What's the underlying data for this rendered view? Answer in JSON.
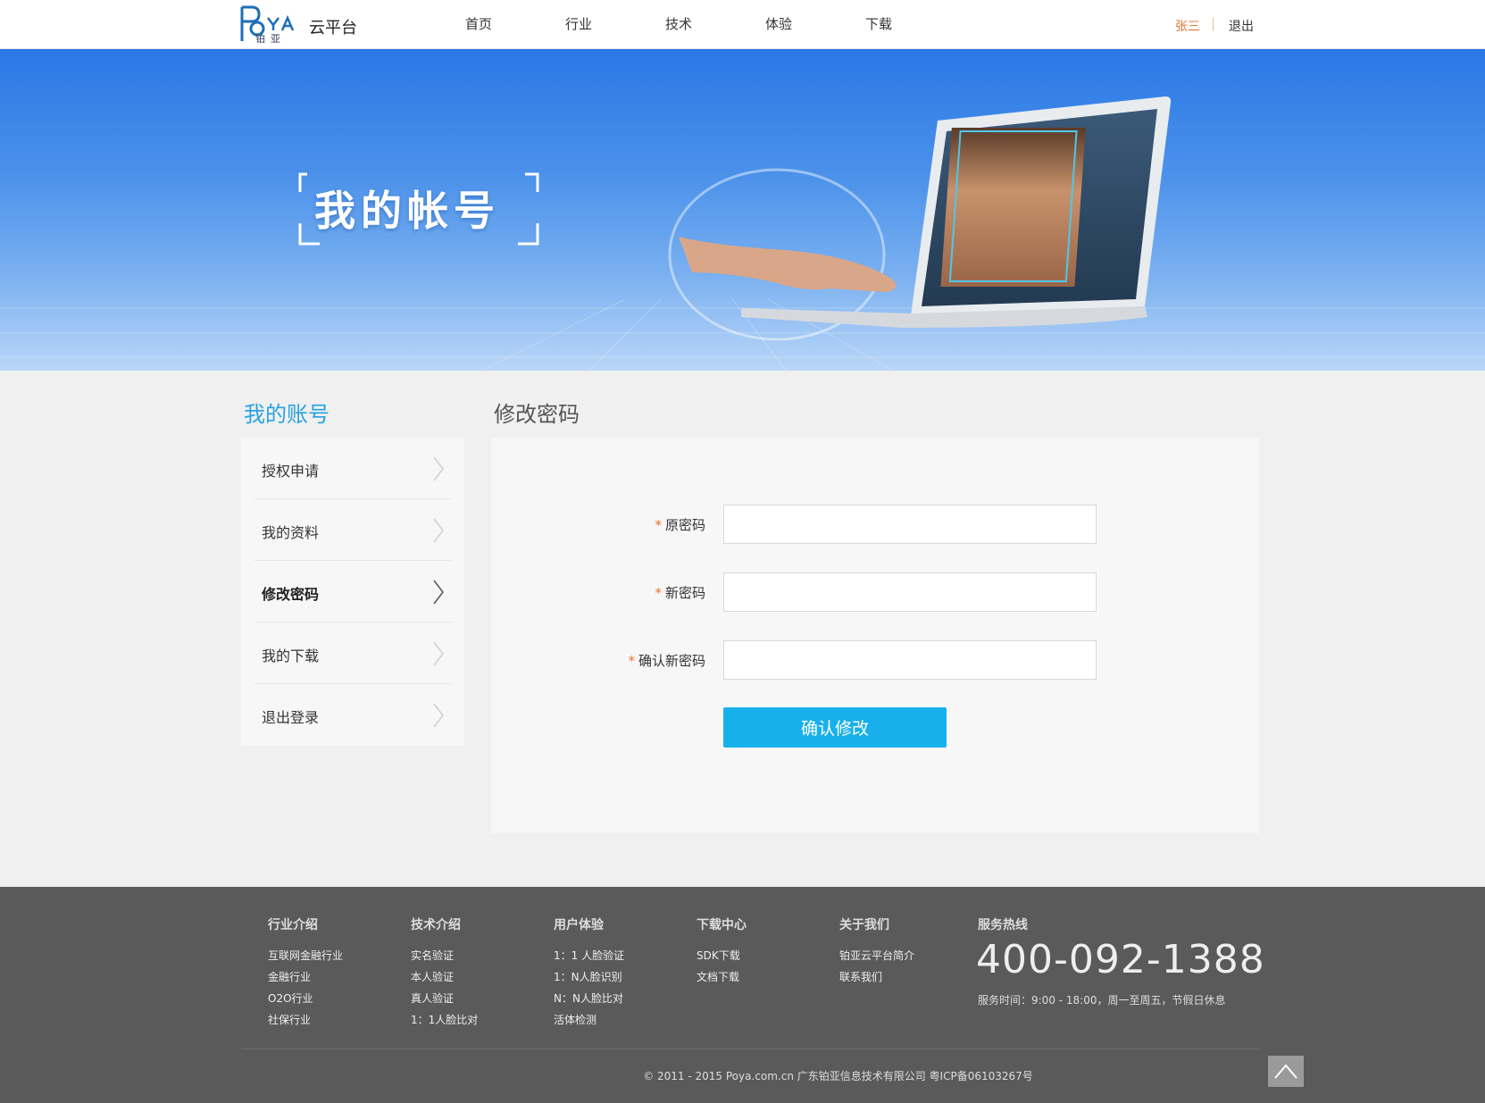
{
  "header": {
    "logo_sub": "铂亚",
    "platform": "云平台",
    "nav": [
      "首页",
      "行业",
      "技术",
      "体验",
      "下载"
    ],
    "user_name": "张三",
    "logout": "退出"
  },
  "banner": {
    "title": "我的帐号"
  },
  "sidebar": {
    "title": "我的账号",
    "items": [
      {
        "label": "授权申请"
      },
      {
        "label": "我的资料"
      },
      {
        "label": "修改密码",
        "active": true
      },
      {
        "label": "我的下载"
      },
      {
        "label": "退出登录"
      }
    ]
  },
  "main": {
    "title": "修改密码",
    "fields": [
      {
        "label": "原密码",
        "value": ""
      },
      {
        "label": "新密码",
        "value": ""
      },
      {
        "label": "确认新密码",
        "value": ""
      }
    ],
    "required_mark": "*",
    "submit": "确认修改"
  },
  "footer": {
    "columns": [
      {
        "title": "行业介绍",
        "links": [
          "互联网金融行业",
          "金融行业",
          "O2O行业",
          "社保行业"
        ]
      },
      {
        "title": "技术介绍",
        "links": [
          "实名验证",
          "本人验证",
          "真人验证",
          "1：1人脸比对"
        ]
      },
      {
        "title": "用户体验",
        "links": [
          "1：1 人脸验证",
          "1：N人脸识别",
          "N：N人脸比对",
          "活体检测"
        ]
      },
      {
        "title": "下载中心",
        "links": [
          "SDK下载",
          "文档下载"
        ]
      },
      {
        "title": "关于我们",
        "links": [
          "铂亚云平台简介",
          "联系我们"
        ]
      }
    ],
    "hotline_title": "服务热线",
    "hotline": "400-092-1388",
    "hours": "服务时间：9:00 - 18:00，周一至周五，节假日休息",
    "copyright": "© 2011 - 2015 Poya.com.cn 广东铂亚信息技术有限公司 粤ICP备06103267号"
  },
  "colors": {
    "accent_blue": "#18b0ec",
    "title_blue": "#28a1e0",
    "user_orange": "#e8742b",
    "footer_bg": "#5a5a5a"
  }
}
